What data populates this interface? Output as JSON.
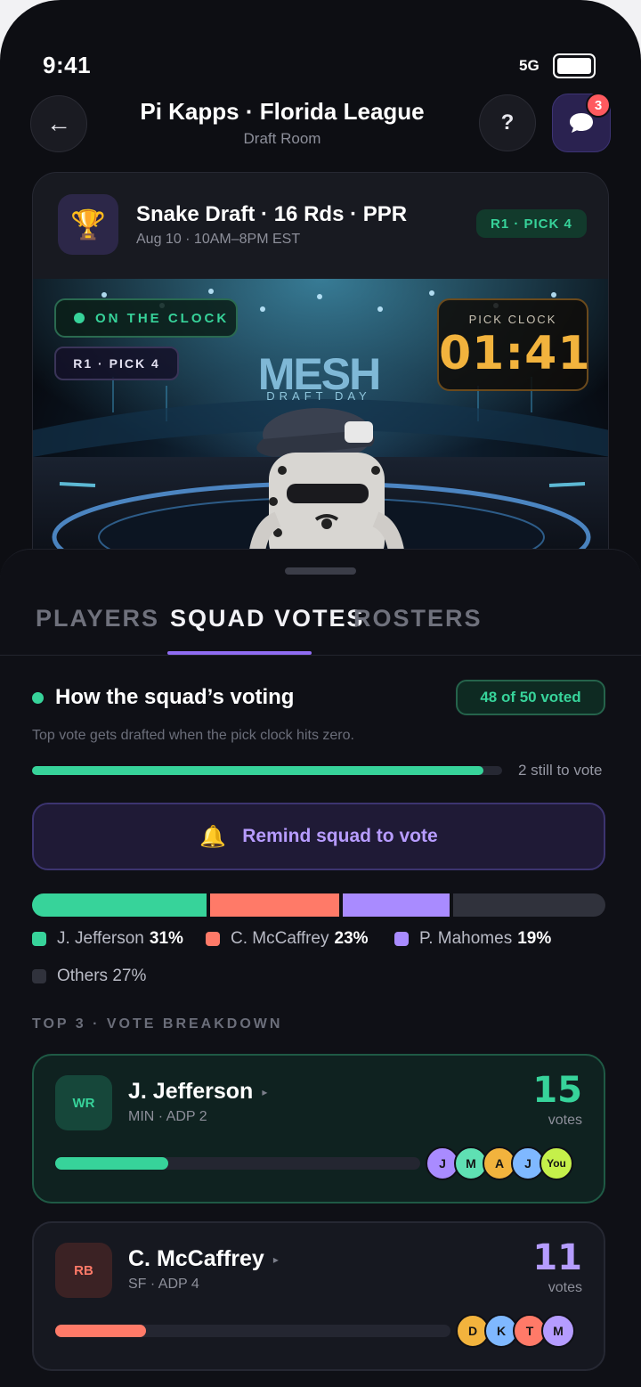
{
  "status": {
    "time": "9:41",
    "network": "5G"
  },
  "header": {
    "title": "Pi Kapps · Florida League",
    "subtitle": "Draft Room",
    "back_icon": "←",
    "help_label": "?",
    "chat_badge": "3"
  },
  "draft": {
    "title": "Snake Draft · 16 Rds · PPR",
    "schedule": "Aug 10 · 10AM–8PM EST",
    "pick_pill": "R1 · PICK 4",
    "trophy_icon": "🏆",
    "hero": {
      "on_the_clock": "ON THE CLOCK",
      "round_pick": "R1 · PICK 4",
      "logo_text": "MESH",
      "logo_sub": "DRAFT DAY",
      "clock_label": "PICK CLOCK",
      "clock_value": "01:41"
    }
  },
  "tabs": [
    {
      "label": "PLAYERS",
      "active": false
    },
    {
      "label": "SQUAD VOTES",
      "active": true
    },
    {
      "label": "ROSTERS",
      "active": false
    }
  ],
  "votes": {
    "title": "How the squad’s voting",
    "voted_pill": "48 of 50 voted",
    "description": "Top vote gets drafted when the pick clock hits zero.",
    "progress_fraction": 0.96,
    "remaining_text": "2 still to vote",
    "remind_label": "Remind squad to vote",
    "bell_icon": "🔔",
    "split": [
      {
        "name": "J. Jefferson",
        "pct": "31%",
        "value": 31,
        "color": "#37d39a"
      },
      {
        "name": "C. McCaffrey",
        "pct": "23%",
        "value": 23,
        "color": "#ff7a68"
      },
      {
        "name": "P. Mahomes",
        "pct": "19%",
        "value": 19,
        "color": "#a98bff"
      },
      {
        "name": "Others",
        "pct": "27%",
        "value": 27,
        "color": "#30323c"
      }
    ],
    "section_label": "TOP 3 · VOTE BREAKDOWN",
    "players": [
      {
        "pos": "WR",
        "name": "J. Jefferson",
        "meta": "MIN · ADP 2",
        "votes": "15",
        "votes_label": "votes",
        "fraction": 0.31,
        "color": "#37d39a",
        "pos_bg": "#16473a",
        "pos_color": "#37d39a",
        "voters": [
          {
            "initial": "J",
            "color": "#a98bff"
          },
          {
            "initial": "M",
            "color": "#5fe0b3"
          },
          {
            "initial": "A",
            "color": "#f2b33d"
          },
          {
            "initial": "J",
            "color": "#7fb8ff"
          },
          {
            "initial": "You",
            "color": "#c5f04a"
          }
        ]
      },
      {
        "pos": "RB",
        "name": "C. McCaffrey",
        "meta": "SF · ADP 4",
        "votes": "11",
        "votes_label": "votes",
        "fraction": 0.23,
        "color": "#ff7a68",
        "pos_bg": "#3b2224",
        "pos_color": "#ff7a68",
        "voters": [
          {
            "initial": "D",
            "color": "#f2b33d"
          },
          {
            "initial": "K",
            "color": "#7fb8ff"
          },
          {
            "initial": "T",
            "color": "#ff7a68"
          },
          {
            "initial": "M",
            "color": "#b59cff"
          }
        ]
      }
    ]
  }
}
